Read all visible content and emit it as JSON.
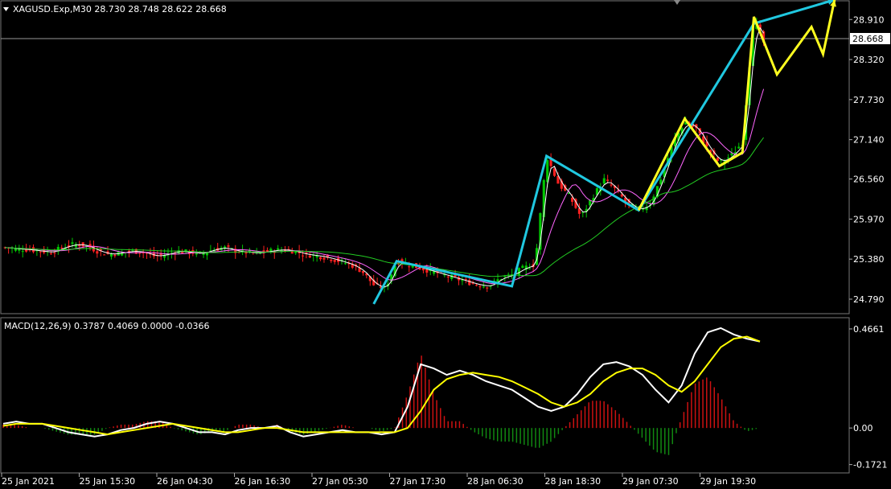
{
  "header": {
    "symbol_line": "XAGUSD.Exp,M30  28.730 28.748 28.622 28.668"
  },
  "price_axis": {
    "ticks": [
      "28.910",
      "28.320",
      "27.730",
      "27.140",
      "26.560",
      "25.970",
      "25.380",
      "24.790"
    ],
    "current_price": "28.668",
    "range": [
      24.6,
      29.15
    ]
  },
  "macd_panel": {
    "label": "MACD(12,26,9) 0.3787 0.4069 0.0000 -0.0366",
    "ticks": [
      "0.4661",
      "0.00",
      "-0.1721"
    ],
    "range": [
      -0.2,
      0.5
    ]
  },
  "time_axis": {
    "labels": [
      "25 Jan 2021",
      "25 Jan 15:30",
      "26 Jan 04:30",
      "26 Jan 16:30",
      "27 Jan 05:30",
      "27 Jan 17:30",
      "28 Jan 06:30",
      "28 Jan 18:30",
      "29 Jan 07:30",
      "29 Jan 19:30"
    ]
  },
  "colors": {
    "background": "#000000",
    "bull": "#00c800",
    "bear": "#ff2020",
    "ma_fast": "#ffffff",
    "ma_mid": "#ff66ff",
    "ma_slow": "#22cc22",
    "zigzag_major": "#20c8e0",
    "zigzag_minor": "#ffff20",
    "macd_line": "#ffffff",
    "signal_line": "#ffff00",
    "hist_pos": "#cc1111",
    "hist_neg": "#118811"
  },
  "chart_data": {
    "type": "candlestick",
    "price_series": [
      25.55,
      25.53,
      25.52,
      25.5,
      25.48,
      25.55,
      25.6,
      25.58,
      25.5,
      25.45,
      25.47,
      25.5,
      25.48,
      25.42,
      25.45,
      25.5,
      25.48,
      25.46,
      25.52,
      25.55,
      25.5,
      25.48,
      25.47,
      25.5,
      25.52,
      25.5,
      25.45,
      25.43,
      25.4,
      25.35,
      25.3,
      25.2,
      25.0,
      24.95,
      25.35,
      25.3,
      25.25,
      25.2,
      25.15,
      25.1,
      25.05,
      25.0,
      24.98,
      25.1,
      25.15,
      25.25,
      25.3,
      26.9,
      26.5,
      26.3,
      26.0,
      26.3,
      26.55,
      26.4,
      26.2,
      26.1,
      26.2,
      26.6,
      27.1,
      27.4,
      27.3,
      27.0,
      26.8,
      26.9,
      27.1,
      28.95,
      28.5,
      28.2,
      28.6,
      28.8,
      28.7,
      28.4,
      28.668
    ],
    "macd": [
      0.02,
      0.03,
      0.02,
      0.02,
      0.0,
      -0.02,
      -0.03,
      -0.04,
      -0.03,
      -0.01,
      0.0,
      0.02,
      0.03,
      0.02,
      0.0,
      -0.02,
      -0.02,
      -0.03,
      -0.01,
      0.0,
      0.0,
      0.01,
      -0.02,
      -0.04,
      -0.03,
      -0.02,
      -0.01,
      -0.02,
      -0.02,
      -0.03,
      -0.02,
      0.1,
      0.3,
      0.28,
      0.25,
      0.27,
      0.25,
      0.22,
      0.2,
      0.18,
      0.14,
      0.1,
      0.08,
      0.1,
      0.16,
      0.24,
      0.3,
      0.31,
      0.29,
      0.25,
      0.18,
      0.12,
      0.2,
      0.35,
      0.45,
      0.47,
      0.44,
      0.42,
      0.4069
    ],
    "signal": [
      0.01,
      0.02,
      0.02,
      0.02,
      0.01,
      0.0,
      -0.01,
      -0.02,
      -0.03,
      -0.02,
      -0.01,
      0.0,
      0.01,
      0.02,
      0.01,
      0.0,
      -0.01,
      -0.02,
      -0.02,
      -0.01,
      0.0,
      0.0,
      -0.01,
      -0.02,
      -0.02,
      -0.02,
      -0.02,
      -0.02,
      -0.02,
      -0.02,
      -0.02,
      0.0,
      0.08,
      0.18,
      0.23,
      0.25,
      0.26,
      0.25,
      0.24,
      0.22,
      0.19,
      0.16,
      0.12,
      0.1,
      0.12,
      0.16,
      0.22,
      0.26,
      0.28,
      0.28,
      0.25,
      0.2,
      0.17,
      0.22,
      0.3,
      0.38,
      0.42,
      0.43,
      0.4069
    ]
  }
}
